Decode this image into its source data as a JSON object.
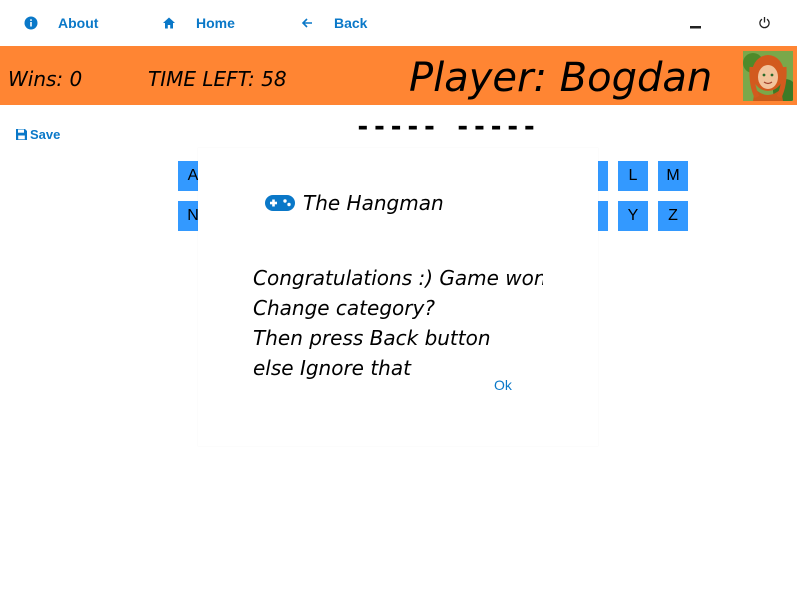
{
  "nav": {
    "about": "About",
    "home": "Home",
    "back": "Back"
  },
  "status": {
    "wins": "Wins: 0",
    "time_left": "TIME LEFT: 58",
    "player": "Player: Bogdan"
  },
  "toolbar": {
    "save": "Save"
  },
  "word": "----- -----",
  "keys": {
    "A": "A",
    "N": "N",
    "L": "L",
    "M": "M",
    "Y": "Y",
    "Z": "Z"
  },
  "dialog": {
    "title": "The Hangman",
    "lines": [
      "Congratulations :) Game won",
      "Change category?",
      "Then press Back button",
      "else Ignore that"
    ],
    "ok": "Ok"
  },
  "colors": {
    "accent": "#0a78c8",
    "header_bg": "#ff8533",
    "key_bg": "#3399ff"
  },
  "icons": {
    "about": "info-icon",
    "home": "home-icon",
    "back": "arrow-left-icon",
    "save": "floppy-disk-icon",
    "dialog": "gamepad-icon",
    "minimize": "minimize-icon",
    "power": "power-icon"
  }
}
